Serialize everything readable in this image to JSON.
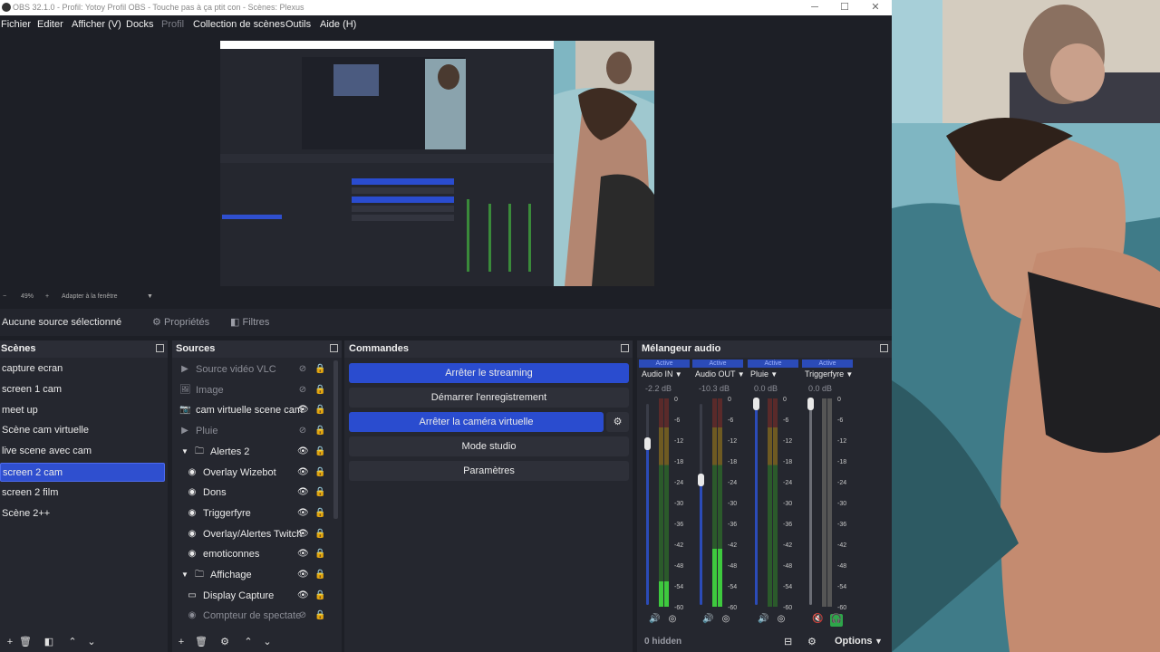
{
  "window": {
    "title": "OBS 32.1.0 - Profil: Yotoy Profil OBS - Touche pas  à ça ptit con - Scènes: Plexus",
    "min": "─",
    "max": "☐",
    "close": "✕"
  },
  "menu": {
    "file": "Fichier",
    "edit": "Editer",
    "view": "Afficher (V)",
    "docks": "Docks",
    "profile": "Profil",
    "scenes": "Collection de scènes",
    "tools": "Outils",
    "help": "Aide (H)"
  },
  "zoom": {
    "minus": "−",
    "value": "49%",
    "plus": "+",
    "fit": "Adapter à la fenêtre"
  },
  "sourcebar": {
    "no_source": "Aucune source sélectionné",
    "properties": "Propriétés",
    "filters": "Filtres"
  },
  "scenes": {
    "title": "Scènes",
    "items": [
      "capture ecran",
      "screen 1 cam",
      "meet up",
      "Scène cam virtuelle",
      "live scene avec cam",
      "screen 2 cam",
      "screen 2 film",
      "Scène 2++"
    ],
    "selected": "screen 2 cam"
  },
  "sources": {
    "title": "Sources",
    "items": [
      {
        "label": "Source vidéo VLC",
        "icon": "play-icon",
        "dim": true
      },
      {
        "label": "Image",
        "icon": "image-icon",
        "dim": true
      },
      {
        "label": "cam virtuelle scene cam",
        "icon": "camera-icon",
        "dim": false
      },
      {
        "label": "Pluie",
        "icon": "play-icon",
        "dim": true
      },
      {
        "label": "Alertes 2",
        "icon": "folder-icon",
        "dim": false
      },
      {
        "label": "Overlay Wizebot",
        "icon": "globe-icon",
        "dim": false
      },
      {
        "label": "Dons",
        "icon": "globe-icon",
        "dim": false
      },
      {
        "label": "Triggerfyre",
        "icon": "globe-icon",
        "dim": false
      },
      {
        "label": "Overlay/Alertes Twitch",
        "icon": "globe-icon",
        "dim": false
      },
      {
        "label": "emoticonnes",
        "icon": "globe-icon",
        "dim": false
      },
      {
        "label": "Affichage",
        "icon": "folder-icon",
        "dim": false
      },
      {
        "label": "Display Capture",
        "icon": "monitor-icon",
        "dim": false
      },
      {
        "label": "Compteur de spectate",
        "icon": "globe-icon",
        "dim": true
      }
    ]
  },
  "commands": {
    "title": "Commandes",
    "stop_stream": "Arrêter le streaming",
    "start_record": "Démarrer l'enregistrement",
    "stop_virtualcam": "Arrêter la caméra virtuelle",
    "studio_mode": "Mode studio",
    "settings": "Paramètres"
  },
  "mixer": {
    "title": "Mélangeur audio",
    "channels": [
      {
        "active": "Active",
        "name": "Audio IN",
        "db": "-2.2 dB",
        "level": 0.12,
        "volume": 0.8
      },
      {
        "active": "Active",
        "name": "Audio OUT",
        "db": "-10.3 dB",
        "level": 0.28,
        "volume": 0.62
      },
      {
        "active": "Active",
        "name": "Pluie",
        "db": "0.0 dB",
        "level": 0.0,
        "volume": 1.0
      },
      {
        "active": "Active",
        "name": "Triggerfyre",
        "db": "0.0 dB",
        "level": 0.0,
        "volume": 1.0
      }
    ],
    "scale": [
      "0",
      "-6",
      "-12",
      "-18",
      "-24",
      "-30",
      "-36",
      "-42",
      "-48",
      "-54",
      "-60"
    ],
    "hidden": "0 hidden",
    "options": "Options"
  },
  "colors": {
    "accent": "#2a4ccf",
    "bg": "#1d1f26",
    "panel": "#25272f"
  }
}
